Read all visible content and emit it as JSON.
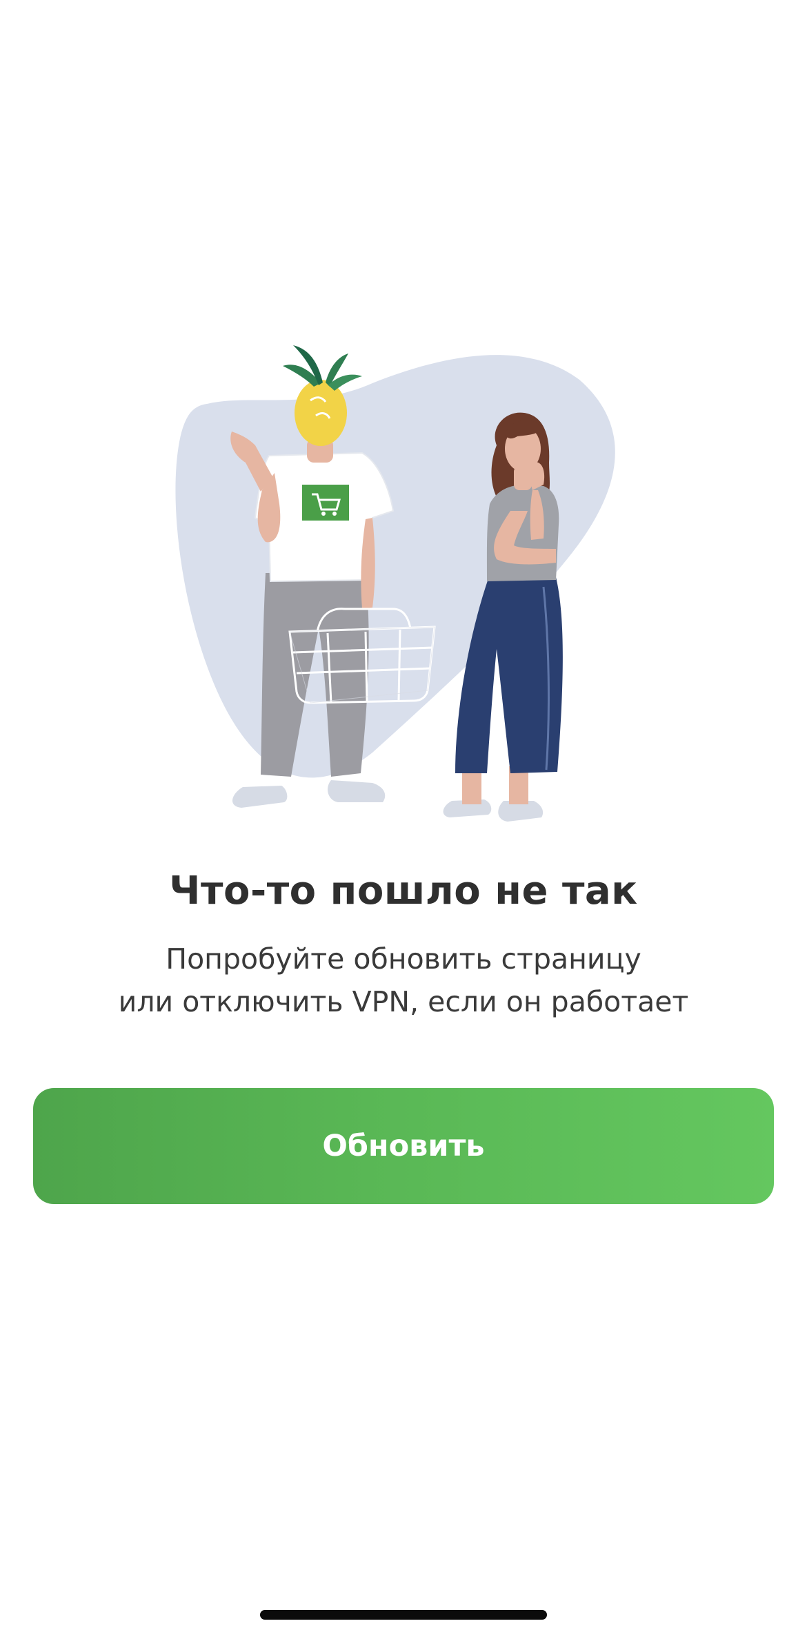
{
  "error": {
    "title": "Что-то пошло не так",
    "message_line1": "Попробуйте обновить страницу",
    "message_line2": "или отключить VPN, если он работает"
  },
  "actions": {
    "refresh_label": "Обновить"
  },
  "illustration": {
    "icon": "pineapple-shopper-illustration"
  },
  "colors": {
    "accent_start": "#4ea54b",
    "accent_end": "#64c75f",
    "blob": "#d9dfec",
    "title": "#2f2f2f",
    "text": "#3a3a3a"
  }
}
